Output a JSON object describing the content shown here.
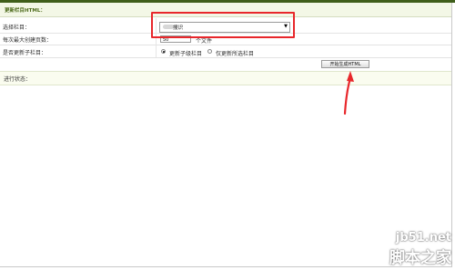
{
  "section_title": "更新栏目HTML：",
  "form": {
    "column_label": "选择栏目：",
    "column_value": "搜识",
    "max_pages_label": "每次最大创建页数：",
    "max_pages_value": "50",
    "max_pages_unit": "个文件",
    "update_sub_label": "是否更新子栏目：",
    "radio_update_sub": "更新子级栏目",
    "radio_only_selected": "仅更新所选栏目",
    "radio_selected": "update_sub"
  },
  "start_button": "开始生成HTML",
  "status_label": "进行状态：",
  "annotation": {
    "box_color": "#e8272b",
    "arrow_color": "#e8272b"
  },
  "watermark": {
    "url": "jb51.net",
    "name": "脚本之家"
  },
  "colors": {
    "title_text": "#4d6b1b",
    "top_bar": "#3f5e1a"
  }
}
